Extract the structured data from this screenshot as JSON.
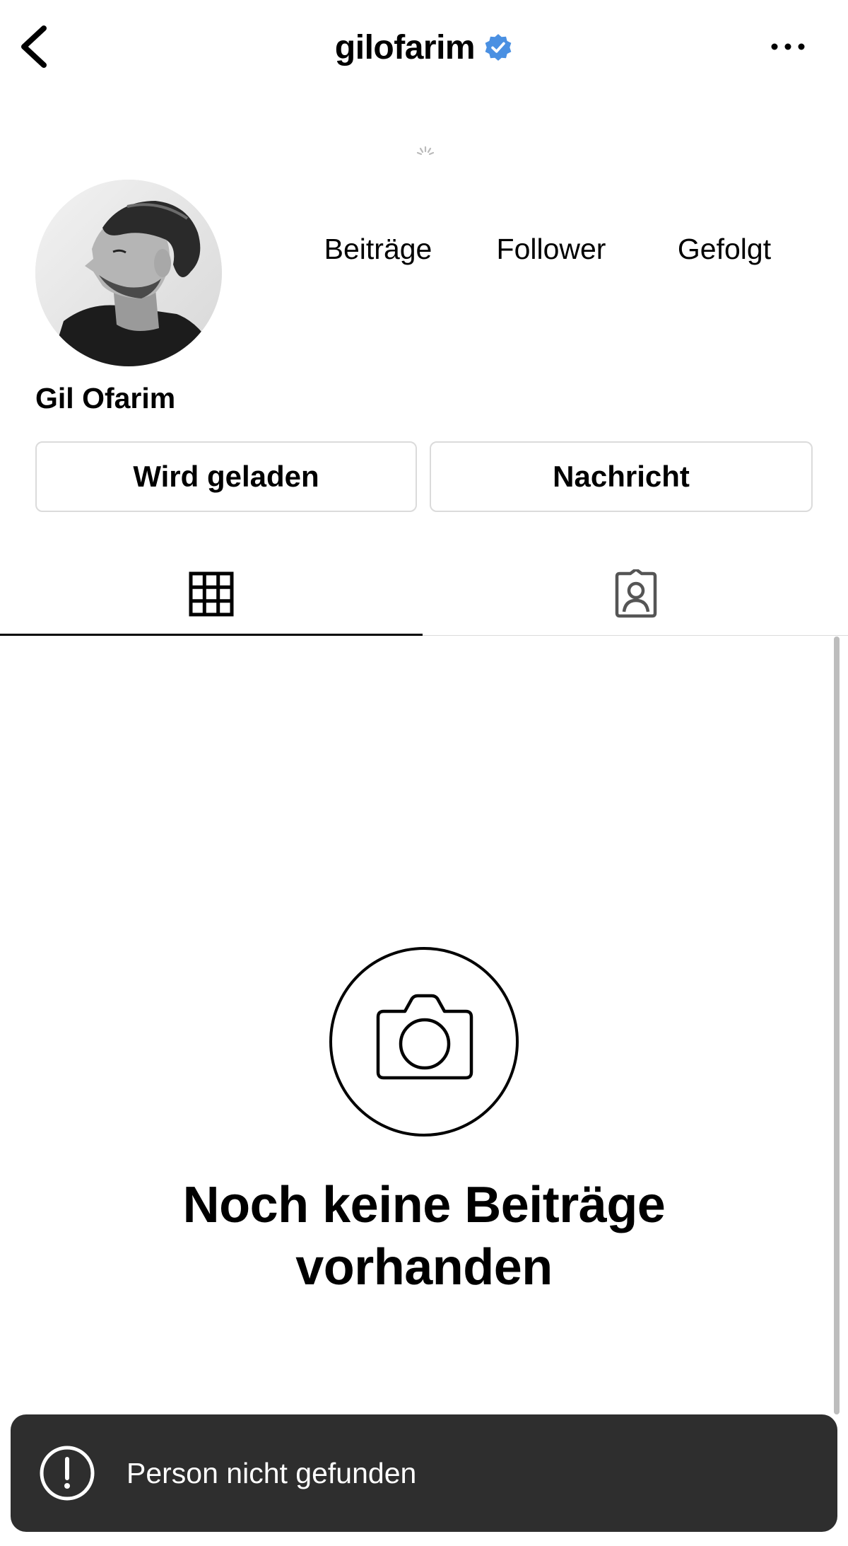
{
  "header": {
    "username": "gilofarim",
    "verified": true,
    "accent_color": "#4a90e2",
    "back_icon": "chevron-left-icon",
    "more_icon": "more-horizontal-icon"
  },
  "profile": {
    "full_name": "Gil Ofarim",
    "stats": {
      "posts_label": "Beiträge",
      "followers_label": "Follower",
      "following_label": "Gefolgt"
    }
  },
  "actions": {
    "follow_label": "Wird geladen",
    "message_label": "Nachricht"
  },
  "tabs": [
    {
      "icon": "grid-icon",
      "active": true
    },
    {
      "icon": "tagged-person-icon",
      "active": false
    }
  ],
  "empty_state": {
    "icon": "camera-icon",
    "title_line1": "Noch keine Beiträge",
    "title_line2": "vorhanden"
  },
  "toast": {
    "icon": "alert-circle-icon",
    "message": "Person nicht gefunden",
    "background": "#2e2e2e"
  }
}
